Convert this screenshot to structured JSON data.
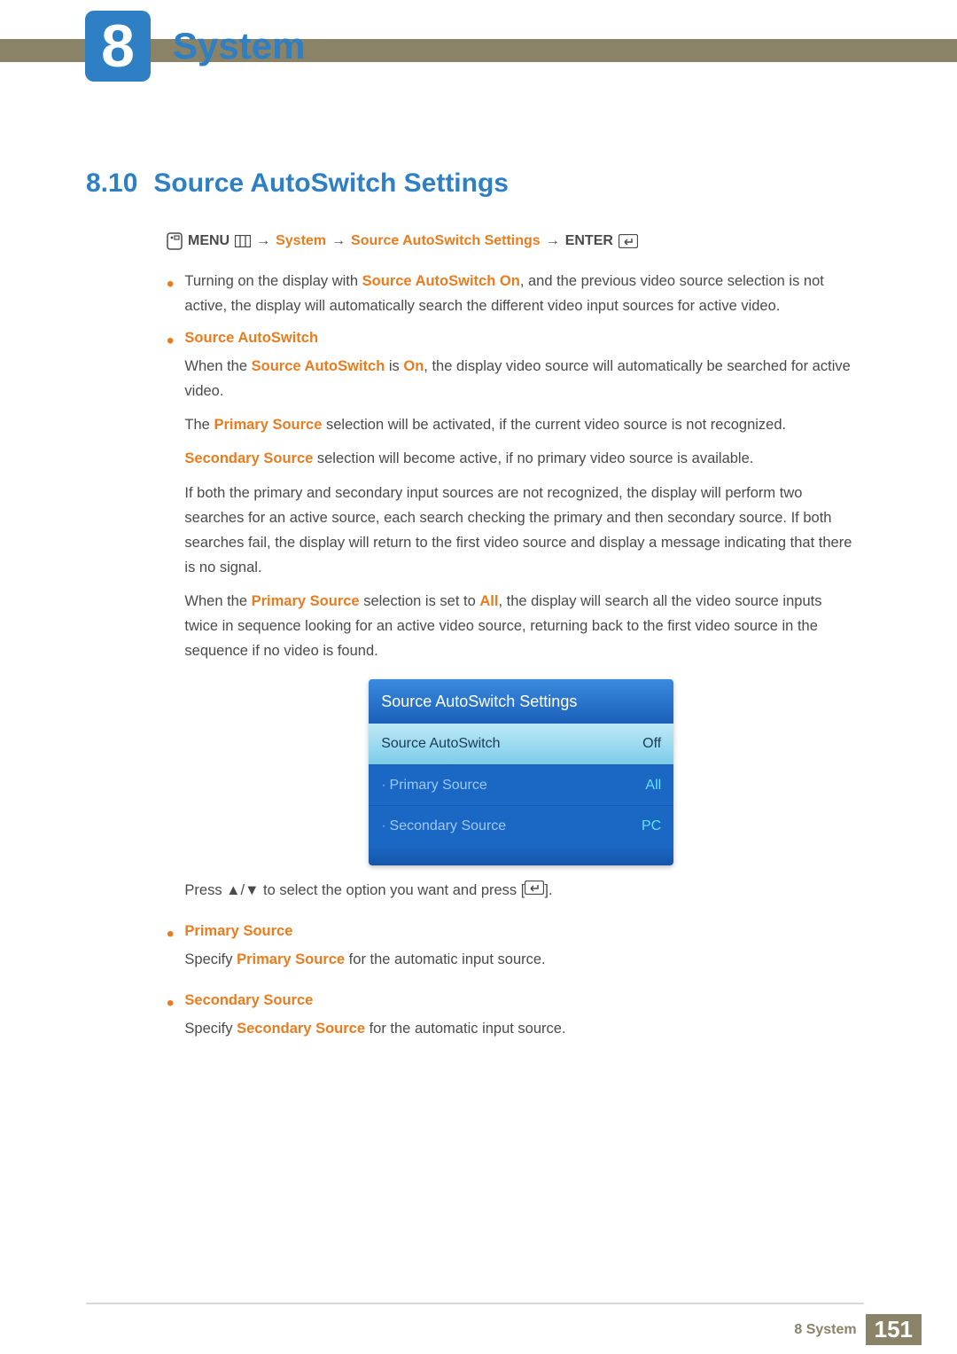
{
  "chapter": {
    "number": "8",
    "title": "System"
  },
  "section": {
    "number": "8.10",
    "title": "Source AutoSwitch Settings"
  },
  "menu_path": {
    "menu": "MENU",
    "arrow": "→",
    "system": "System",
    "setting": "Source AutoSwitch Settings",
    "enter": "ENTER"
  },
  "intro_bullet": {
    "pre": "Turning on the display with ",
    "term": "Source AutoSwitch On",
    "post": ", and the previous video source selection is not active, the display will automatically search the different video input sources for active video."
  },
  "autoswitch": {
    "heading": "Source AutoSwitch",
    "p1": {
      "pre": "When the ",
      "t1": "Source AutoSwitch",
      "mid": " is ",
      "t2": "On",
      "post": ", the display video source will automatically be searched for active video."
    },
    "p2": {
      "pre": "The ",
      "t1": "Primary Source",
      "post": " selection will be activated, if the current video source is not recognized."
    },
    "p3": {
      "t1": "Secondary Source",
      "post": " selection will become active, if no primary video source is available."
    },
    "p4": "If both the primary and secondary input sources are not recognized, the display will perform two searches for an active source, each search checking the primary and then secondary source. If both searches fail, the display will return to the first video source and display a message indicating that there is no signal.",
    "p5": {
      "pre": "When the ",
      "t1": "Primary Source",
      "mid": " selection is set to ",
      "t2": "All",
      "post": ", the display will search all the video source inputs twice in sequence looking for an active video source, returning back to the first video source in the sequence if no video is found."
    }
  },
  "osd": {
    "title": "Source AutoSwitch Settings",
    "rows": [
      {
        "label": "Source AutoSwitch",
        "value": "Off",
        "selected": true
      },
      {
        "label": "Primary Source",
        "value": "All",
        "selected": false
      },
      {
        "label": "Secondary Source",
        "value": "PC",
        "selected": false
      }
    ]
  },
  "press_instruction": {
    "pre": "Press  ▲/▼ to select the option you want and press [",
    "post": "]."
  },
  "primary": {
    "heading": "Primary Source",
    "text_pre": "Specify ",
    "term": "Primary Source",
    "text_post": " for the automatic input source."
  },
  "secondary": {
    "heading": "Secondary Source",
    "text_pre": "Specify ",
    "term": "Secondary Source",
    "text_post": " for the automatic input source."
  },
  "footer": {
    "label": "8 System",
    "page": "151"
  }
}
